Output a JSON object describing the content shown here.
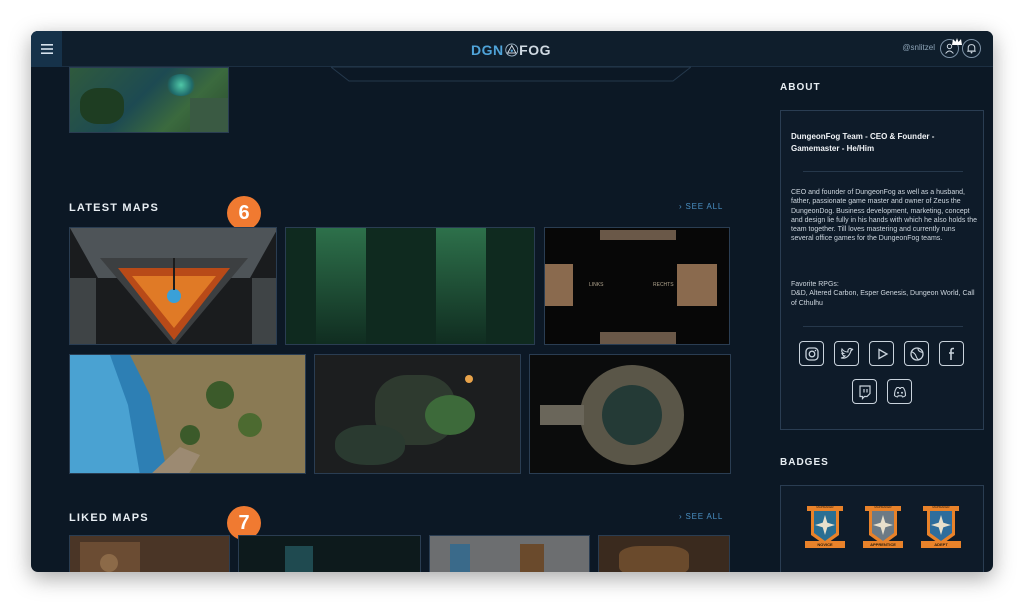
{
  "header": {
    "logo_left": "DGN",
    "logo_right": "FOG",
    "username": "@snlitzel"
  },
  "sections": {
    "latest": {
      "title": "LATEST MAPS",
      "see_all": "SEE ALL",
      "marker": "6"
    },
    "liked": {
      "title": "LIKED MAPS",
      "see_all": "SEE ALL",
      "marker": "7"
    }
  },
  "map_labels": {
    "left": "LINKS",
    "right": "RECHTS"
  },
  "about": {
    "title": "ABOUT",
    "heading": "DungeonFog Team - CEO & Founder - Gamemaster - He/Him",
    "body": "CEO and founder of DungeonFog as well as a husband, father, passionate game master and owner of Zeus the DungeonDog. Business development, marketing, concept and design lie fully in his hands with which he also holds the team together. Till loves mastering and currently runs several office games for the DungeonFog teams.",
    "rpg_label": "Favorite RPGs:",
    "rpg_list": "D&D, Altered Carbon, Esper Genesis, Dungeon World, Call of Cthulhu",
    "socials": [
      "instagram-icon",
      "twitter-icon",
      "youtube-icon",
      "website-icon",
      "facebook-icon",
      "twitch-icon",
      "discord-icon"
    ]
  },
  "badges": {
    "title": "BADGES",
    "items": [
      {
        "top": "MAPMAKER",
        "bottom": "NOVICE",
        "color": "#2a6f93"
      },
      {
        "top": "MAPMAKER",
        "bottom": "APPRENTICE",
        "color": "#6c7a85"
      },
      {
        "top": "MAPMAKER",
        "bottom": "ADEPT",
        "color": "#2e6d9c"
      }
    ]
  },
  "colors": {
    "accent": "#4a8fc2",
    "marker": "#f07a31",
    "background": "#0c1825"
  }
}
